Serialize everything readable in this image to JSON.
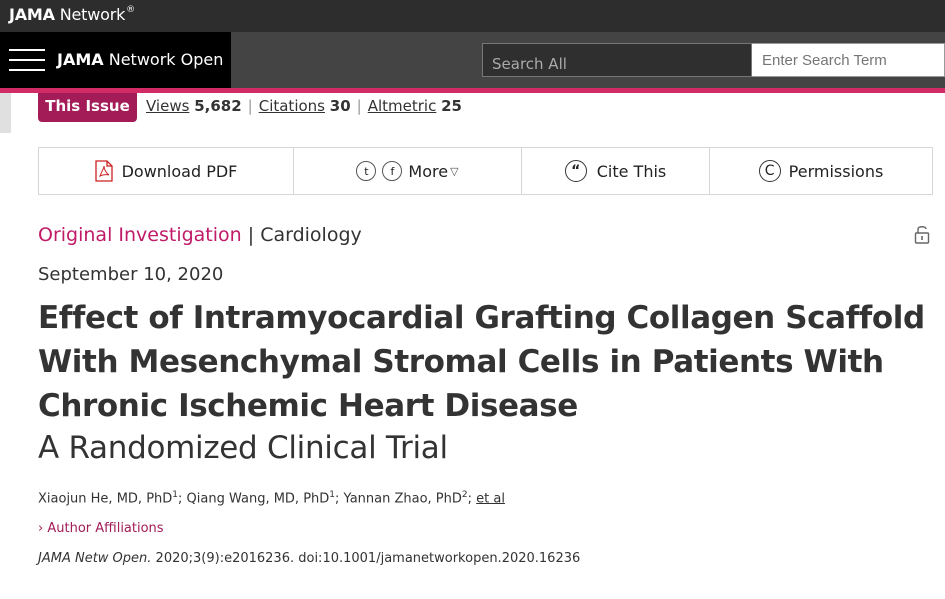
{
  "network": {
    "brand_bold": "JAMA",
    "brand_rest": " Network",
    "brand_mark": "®"
  },
  "header": {
    "journal_bold": "JAMA",
    "journal_rest": " Network Open",
    "search_all_label": "Search All",
    "search_placeholder": "Enter Search Term"
  },
  "metrics": {
    "issue_label": "This Issue",
    "views_label": "Views",
    "views_value": "5,682",
    "citations_label": "Citations",
    "citations_value": "30",
    "altmetric_label": "Altmetric",
    "altmetric_value": "25"
  },
  "toolbar": {
    "download_label": "Download PDF",
    "twitter_glyph": "t",
    "facebook_glyph": "f",
    "more_label": "More",
    "cite_label": "Cite This",
    "permissions_label": "Permissions"
  },
  "article": {
    "type": "Original Investigation",
    "separator": " | ",
    "section": "Cardiology",
    "date": "September 10, 2020",
    "title": "Effect of Intramyocardial Grafting Collagen Scaffold With Mesenchymal Stromal Cells in Patients With Chronic Ischemic Heart Disease",
    "subtitle": "A Randomized Clinical Trial",
    "author1": "Xiaojun He, MD, PhD",
    "author1_sup": "1",
    "author2": "; Qiang Wang, MD, PhD",
    "author2_sup": "1",
    "author3": "; Yannan Zhao, PhD",
    "author3_sup": "2",
    "author_sep": "; ",
    "et_al": "et al",
    "affiliations_label": "Author Affiliations",
    "citation_journal": "JAMA Netw Open.",
    "citation_rest": " 2020;3(9):e2016236. doi:10.1001/jamanetworkopen.2020.16236"
  },
  "colors": {
    "accent_pink": "#d22b66",
    "issue_bg": "#a31c57",
    "category_pink": "#c01a68"
  }
}
